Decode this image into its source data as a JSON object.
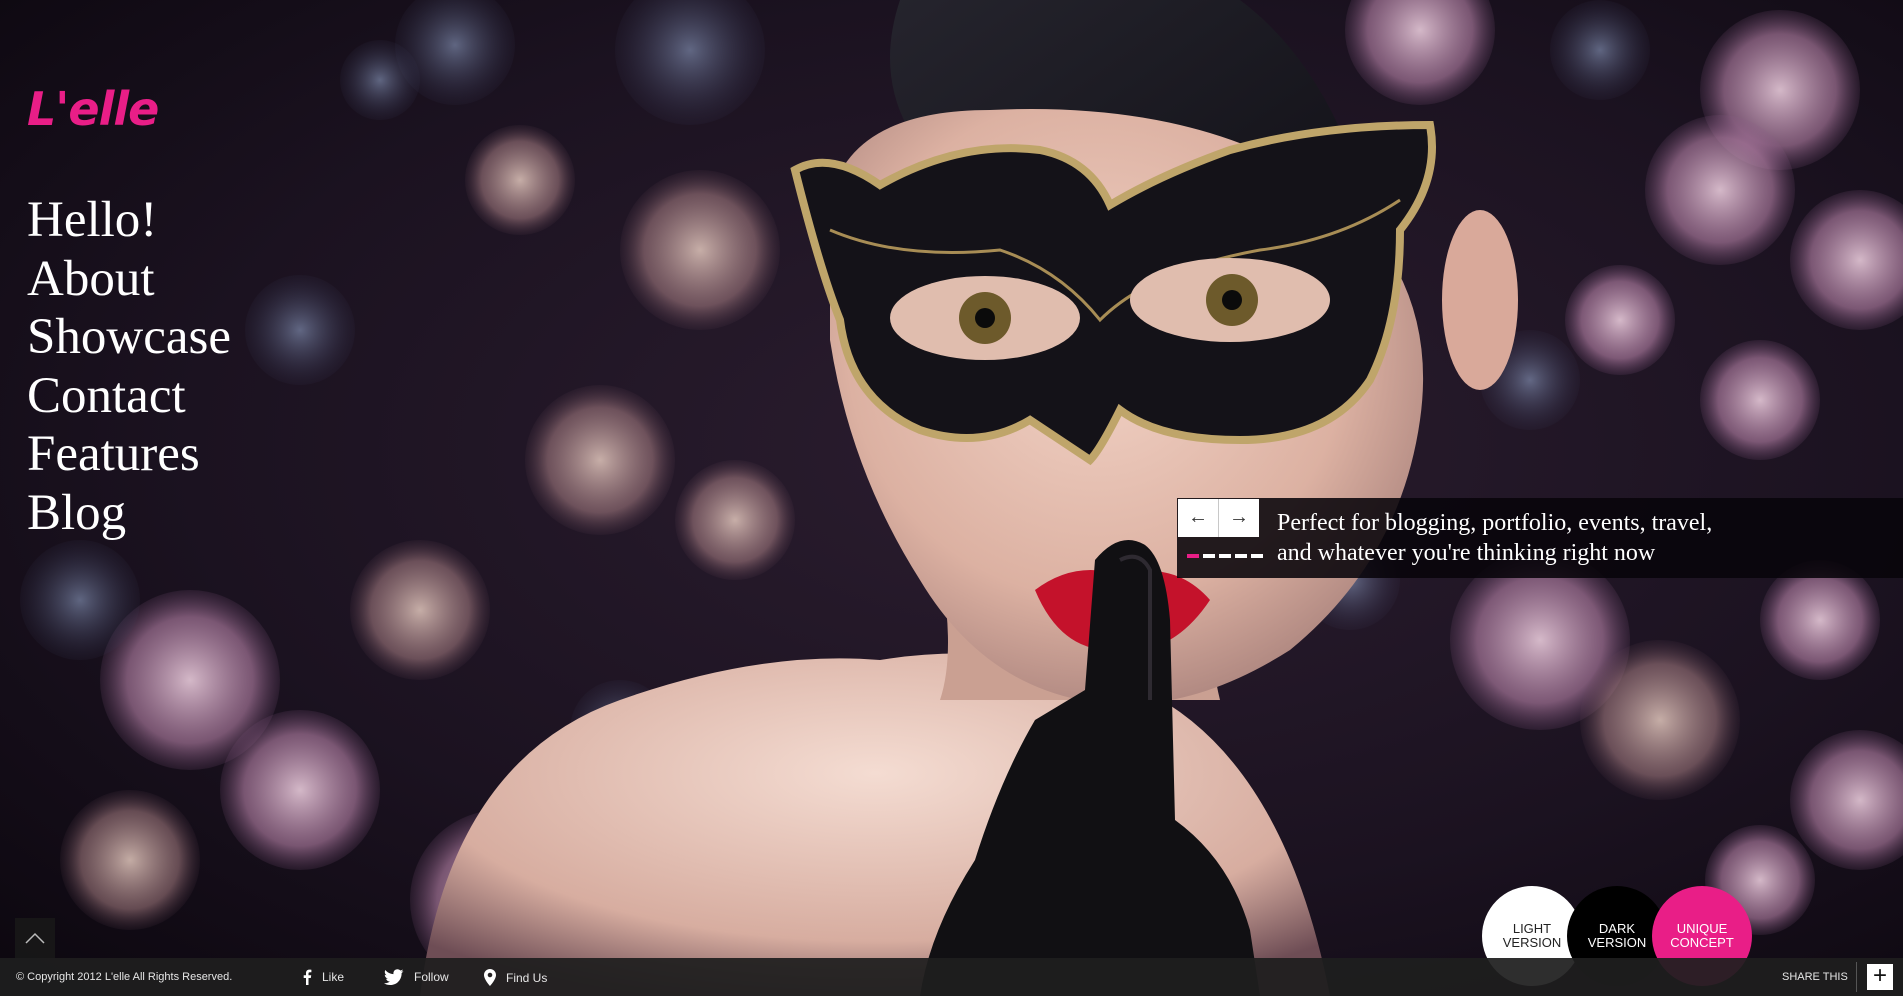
{
  "brand": {
    "logo_text": "L'elle",
    "accent": "#e91e87"
  },
  "nav": {
    "items": [
      {
        "label": "Hello!"
      },
      {
        "label": "About"
      },
      {
        "label": "Showcase"
      },
      {
        "label": "Contact"
      },
      {
        "label": "Features"
      },
      {
        "label": "Blog"
      }
    ]
  },
  "hero": {
    "image": "woman-masquerade-mask-photo",
    "prev_icon": "←",
    "next_icon": "→",
    "slide_count": 5,
    "active_slide": 1,
    "caption": "Perfect for blogging, portfolio, events, travel,\nand whatever you're thinking right now"
  },
  "versions": {
    "light": "LIGHT\nVERSION",
    "dark": "DARK\nVERSION",
    "unique": "UNIQUE\nCONCEPT"
  },
  "footer": {
    "copyright": "© Copyright 2012 L'elle All Rights Reserved.",
    "like": "Like",
    "follow": "Follow",
    "find_us": "Find Us",
    "share_label": "SHARE THIS",
    "share_icon": "+"
  },
  "colors": {
    "background": "#140d18",
    "footer": "#1e1e1e",
    "dark_version": "#000000",
    "light_version": "#ffffff"
  }
}
